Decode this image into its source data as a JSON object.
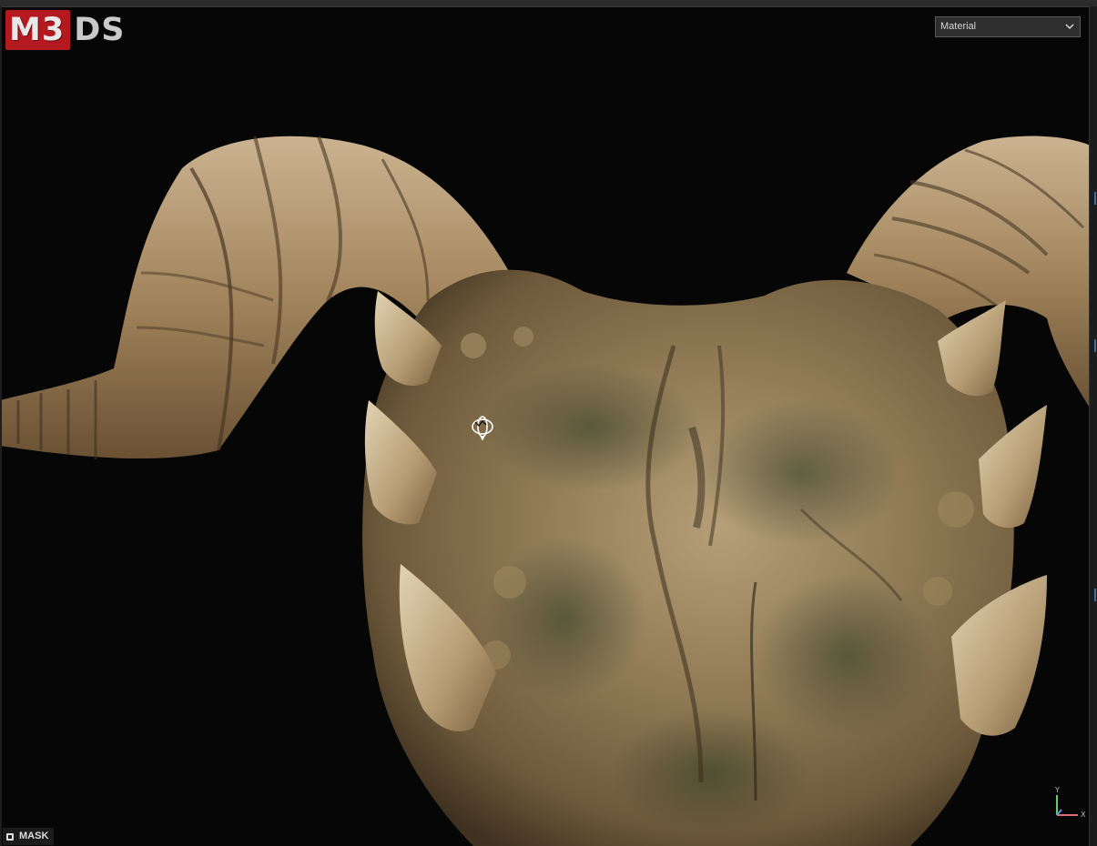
{
  "app": {
    "logo_mark": "M3",
    "logo_text": "DS"
  },
  "viewport": {
    "render_mode": {
      "selected": "Material"
    },
    "mask_button": {
      "label": "MASK"
    },
    "axis_gizmo": {
      "y_label": "Y",
      "x_label": "X"
    },
    "subject": "horned-skull-3d-model"
  },
  "colors": {
    "background": "#060606",
    "logo_red": "#b3191f",
    "bone": "#b8a17c",
    "bone_dark": "#6b5535",
    "horn": "#9a7f5c"
  },
  "icons": {
    "dropdown": "chevron-down-icon",
    "mask": "square-icon",
    "cursor": "rotate-cursor-icon",
    "gizmo": "axis-gizmo-icon"
  }
}
